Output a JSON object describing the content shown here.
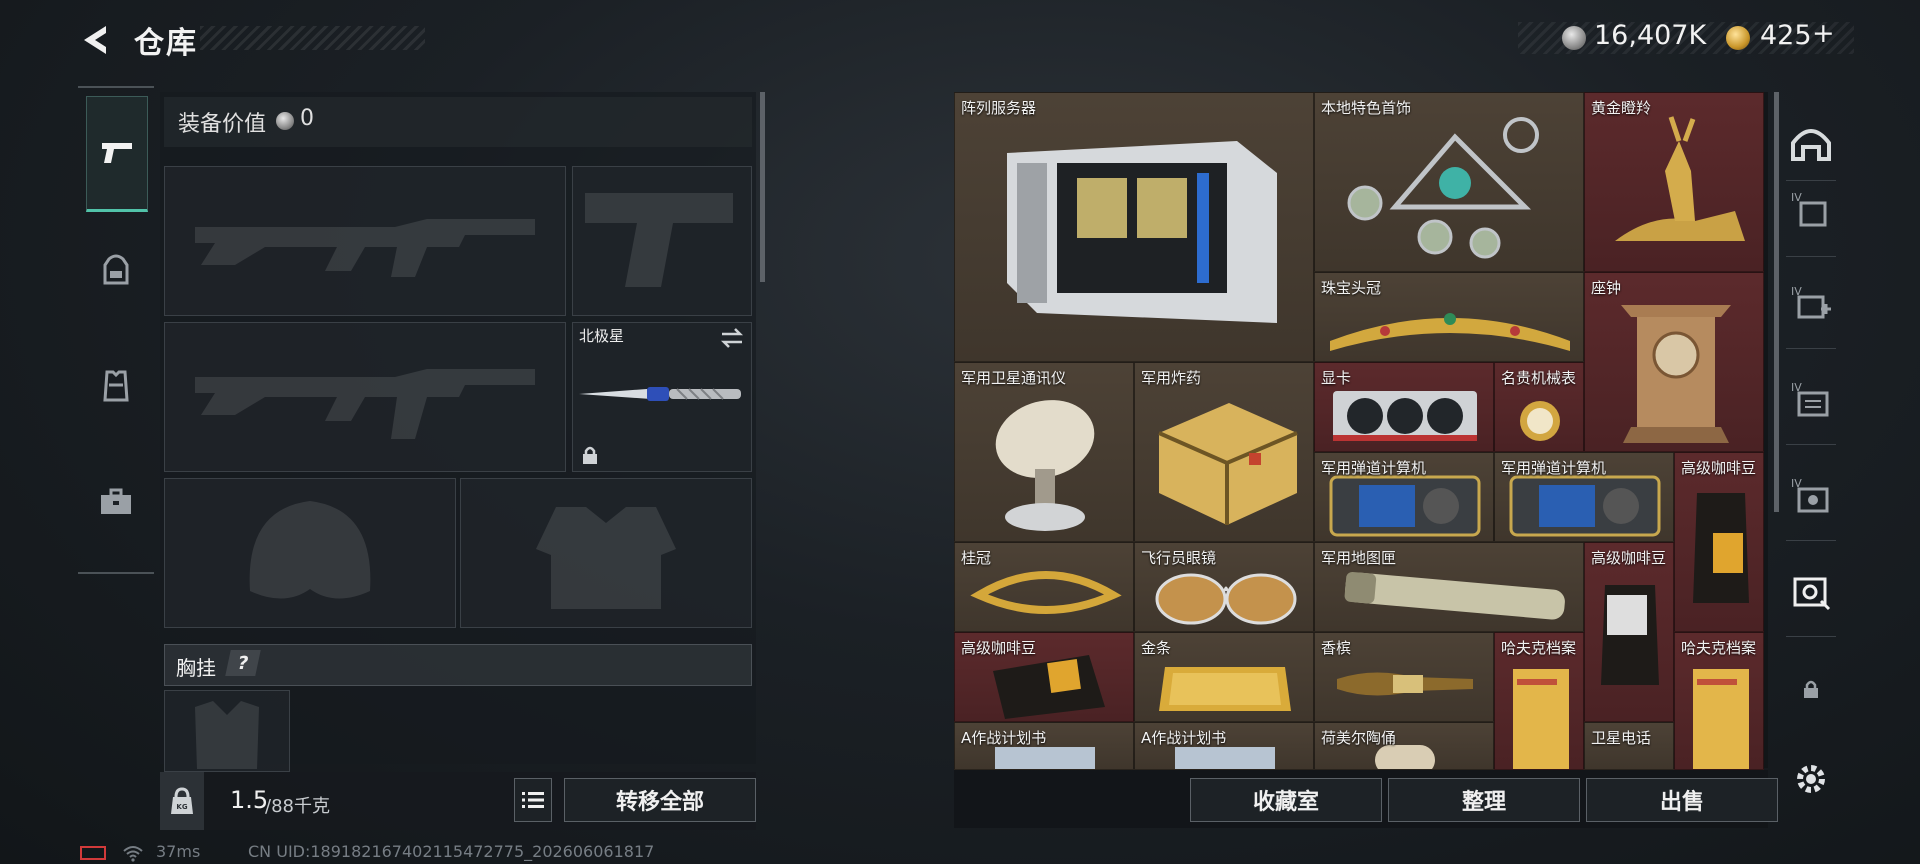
{
  "header": {
    "title": "仓库"
  },
  "currency": {
    "silver": "16,407K",
    "gold": "425",
    "gold_plus": "+"
  },
  "nav": {
    "items": [
      "weapon",
      "backpack",
      "armor",
      "case"
    ]
  },
  "loadout": {
    "value_label": "装备价值",
    "value": "0",
    "secondary_weapon_name": "北极星",
    "chest_rig_label": "胸挂",
    "chest_rig_help": "?",
    "weight_current": "1.5",
    "weight_max": "/88千克",
    "transfer_all": "转移全部"
  },
  "storage": {
    "items": [
      "阵列服务器",
      "本地特色首饰",
      "黄金瞪羚",
      "珠宝头冠",
      "座钟",
      "军用卫星通讯仪",
      "军用炸药",
      "显卡",
      "名贵机械表",
      "军用弹道计算机",
      "军用弹道计算机",
      "高级咖啡豆",
      "桂冠",
      "飞行员眼镜",
      "军用地图匣",
      "高级咖啡豆",
      "高级咖啡豆",
      "金条",
      "香槟",
      "哈夫克档案",
      "哈夫克档案",
      "A作战计划书",
      "A作战计划书",
      "荷美尔陶俑",
      "卫星电话"
    ],
    "buttons": {
      "collection": "收藏室",
      "organize": "整理",
      "sell": "出售"
    }
  },
  "status": {
    "ping": "37ms",
    "uid": "CN UID:189182167402115472775_202606061817"
  },
  "colors": {
    "accent": "#51c3a9",
    "rare_cell": "#5c2a2c",
    "common_cell": "#4d4236"
  }
}
